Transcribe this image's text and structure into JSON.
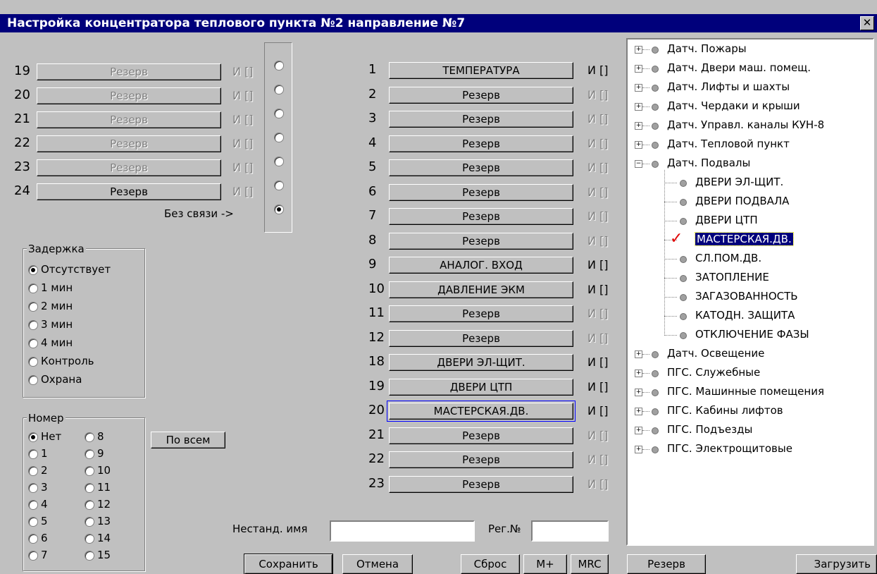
{
  "window": {
    "title": "Настройка концентратора теплового пункта №2 направление №7",
    "close": "✕"
  },
  "left_channels": [
    {
      "num": "19",
      "label": "Резерв",
      "ind": "И []"
    },
    {
      "num": "20",
      "label": "Резерв",
      "ind": "И []"
    },
    {
      "num": "21",
      "label": "Резерв",
      "ind": "И []"
    },
    {
      "num": "22",
      "label": "Резерв",
      "ind": "И []"
    },
    {
      "num": "23",
      "label": "Резерв",
      "ind": "И []"
    },
    {
      "num": "24",
      "label": "Резерв",
      "ind": "И []"
    }
  ],
  "no_connection_label": "Без связи ->",
  "right_channels": [
    {
      "num": "1",
      "label": "ТЕМПЕРАТУРА",
      "ind": "И []"
    },
    {
      "num": "2",
      "label": "Резерв",
      "ind": "И []"
    },
    {
      "num": "3",
      "label": "Резерв",
      "ind": "И []"
    },
    {
      "num": "4",
      "label": "Резерв",
      "ind": "И []"
    },
    {
      "num": "5",
      "label": "Резерв",
      "ind": "И []"
    },
    {
      "num": "6",
      "label": "Резерв",
      "ind": "И []"
    },
    {
      "num": "7",
      "label": "Резерв",
      "ind": "И []"
    },
    {
      "num": "8",
      "label": "Резерв",
      "ind": "И []"
    },
    {
      "num": "9",
      "label": "АНАЛОГ. ВХОД",
      "ind": "И []"
    },
    {
      "num": "10",
      "label": "ДАВЛЕНИЕ ЭКМ",
      "ind": "И []"
    },
    {
      "num": "11",
      "label": "Резерв",
      "ind": "И []"
    },
    {
      "num": "12",
      "label": "Резерв",
      "ind": "И []"
    },
    {
      "num": "18",
      "label": "ДВЕРИ ЭЛ-ЩИТ.",
      "ind": "И []"
    },
    {
      "num": "19",
      "label": "ДВЕРИ ЦТП",
      "ind": "И []"
    },
    {
      "num": "20",
      "label": "МАСТЕРСКАЯ.ДВ.",
      "ind": "И []"
    },
    {
      "num": "21",
      "label": "Резерв",
      "ind": "И []"
    },
    {
      "num": "22",
      "label": "Резерв",
      "ind": "И []"
    },
    {
      "num": "23",
      "label": "Резерв",
      "ind": "И []"
    }
  ],
  "delay": {
    "legend": "Задержка",
    "options": [
      "Отсутствует",
      "1 мин",
      "2 мин",
      "3 мин",
      "4 мин",
      "Контроль",
      "Охрана"
    ],
    "selected": "Отсутствует"
  },
  "number": {
    "legend": "Номер",
    "col1": [
      "Нет",
      "1",
      "2",
      "3",
      "4",
      "5",
      "6",
      "7"
    ],
    "col2": [
      "8",
      "9",
      "10",
      "11",
      "12",
      "13",
      "14",
      "15"
    ],
    "selected": "Нет"
  },
  "buttons": {
    "all": "По всем",
    "save": "Сохранить",
    "cancel": "Отмена",
    "reset": "Сброс",
    "mplus": "M+",
    "mrc": "MRC",
    "reserve": "Резерв",
    "load": "Загрузить"
  },
  "fields": {
    "nonstd_label": "Нестанд. имя",
    "nonstd_value": "",
    "reg_label": "Рег.№",
    "reg_value": ""
  },
  "tree": {
    "groups_top": [
      "Датч. Пожары",
      "Датч. Двери маш. помещ.",
      "Датч. Лифты и шахты",
      "Датч. Чердаки и крыши",
      "Датч. Управл. каналы КУН-8",
      "Датч. Тепловой пункт",
      "Датч. Подвалы"
    ],
    "children": [
      "ДВЕРИ ЭЛ-ЩИТ.",
      "ДВЕРИ ПОДВАЛА",
      "ДВЕРИ ЦТП",
      "МАСТЕРСКАЯ.ДВ.",
      "СЛ.ПОМ.ДВ.",
      "ЗАТОПЛЕНИЕ",
      "ЗАГАЗОВАННОСТЬ",
      "КАТОДН. ЗАЩИТА",
      "ОТКЛЮЧЕНИЕ ФАЗЫ"
    ],
    "selected_child": "МАСТЕРСКАЯ.ДВ.",
    "groups_bottom": [
      "Датч. Освещение",
      "ПГС. Служебные",
      "ПГС. Машинные помещения",
      "ПГС. Кабины лифтов",
      "ПГС. Подъезды",
      "ПГС. Электрощитовые"
    ]
  },
  "colors": {
    "titlebar": "#00007b",
    "face": "#c0c0c0",
    "selection": "#00007b",
    "check": "#e00000",
    "focus": "#0000ff"
  }
}
